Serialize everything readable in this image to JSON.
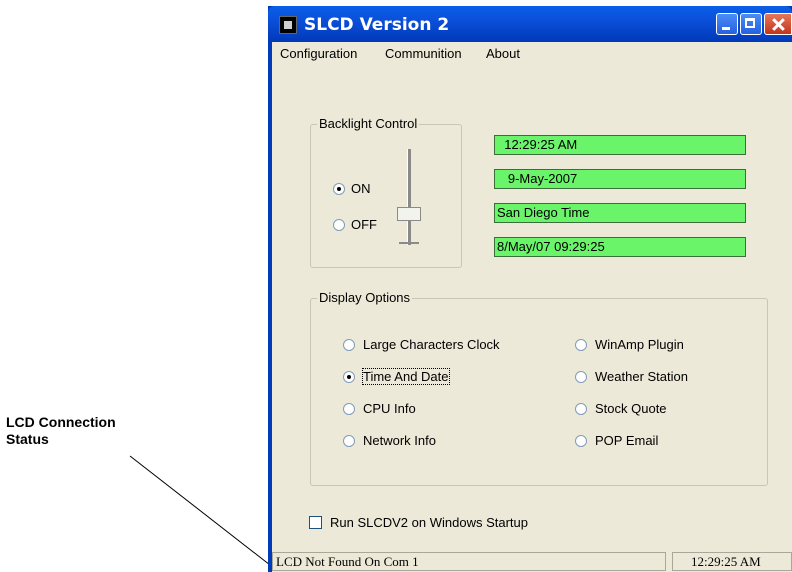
{
  "callout": {
    "line1": "LCD Connection",
    "line2": "Status"
  },
  "window": {
    "title": "SLCD Version 2"
  },
  "menu": {
    "items": [
      "Configuration",
      "Communition",
      "About"
    ]
  },
  "backlight": {
    "legend": "Backlight Control",
    "options": [
      {
        "label": "ON",
        "checked": true
      },
      {
        "label": "OFF",
        "checked": false
      }
    ]
  },
  "lcd_lines": [
    "  12:29:25 AM",
    "   9-May-2007",
    "San Diego Time",
    "8/May/07 09:29:25"
  ],
  "display_options": {
    "legend": "Display Options",
    "left": [
      {
        "label": "Large Characters Clock",
        "checked": false
      },
      {
        "label": "Time And Date",
        "checked": true
      },
      {
        "label": "CPU Info",
        "checked": false
      },
      {
        "label": "Network Info",
        "checked": false
      }
    ],
    "right": [
      {
        "label": "WinAmp Plugin",
        "checked": false
      },
      {
        "label": "Weather Station",
        "checked": false
      },
      {
        "label": "Stock Quote",
        "checked": false
      },
      {
        "label": "POP Email",
        "checked": false
      }
    ]
  },
  "startup": {
    "label": "Run SLCDV2 on Windows Startup",
    "checked": false
  },
  "status": {
    "connection": "LCD Not Found On Com 1",
    "time": "12:29:25 AM"
  }
}
